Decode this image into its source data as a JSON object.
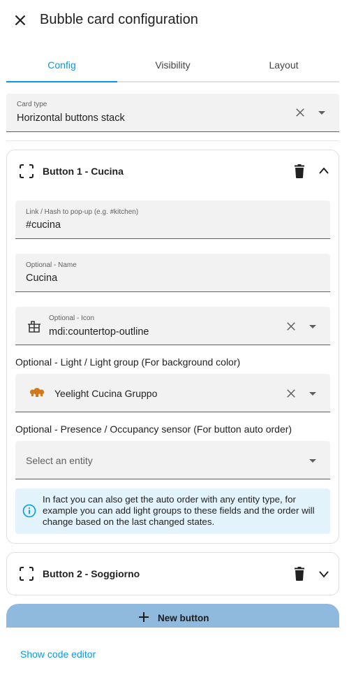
{
  "dialog": {
    "title": "Bubble card configuration"
  },
  "tabs": [
    {
      "label": "Config",
      "active": true
    },
    {
      "label": "Visibility",
      "active": false
    },
    {
      "label": "Layout",
      "active": false
    }
  ],
  "card_type": {
    "label": "Card type",
    "value": "Horizontal buttons stack"
  },
  "button1": {
    "title": "Button 1 - Cucina",
    "link_field": {
      "label": "Link / Hash to pop-up (e.g. #kitchen)",
      "value": "#cucina"
    },
    "name_field": {
      "label": "Optional - Name",
      "value": "Cucina"
    },
    "icon_field": {
      "label": "Optional - Icon",
      "value": "mdi:countertop-outline"
    },
    "light_section_label": "Optional - Light / Light group (For background color)",
    "light_field": {
      "value": "Yeelight Cucina Gruppo"
    },
    "presence_section_label": "Optional - Presence / Occupancy sensor (For button auto order)",
    "presence_field": {
      "placeholder": "Select an entity"
    },
    "info_text": "In fact you can also get the auto order with any entity type, for example you can add light groups to these fields and the order will change based on the last changed states."
  },
  "button2": {
    "title": "Button 2 - Soggiorno"
  },
  "actions": {
    "new_button_label": "New button",
    "code_editor_label": "Show code editor"
  },
  "colors": {
    "accent": "#039be5",
    "light_icon": "#d4781e",
    "new_button_bg": "#8fb9dd",
    "info_bg": "#e3f3fc"
  }
}
